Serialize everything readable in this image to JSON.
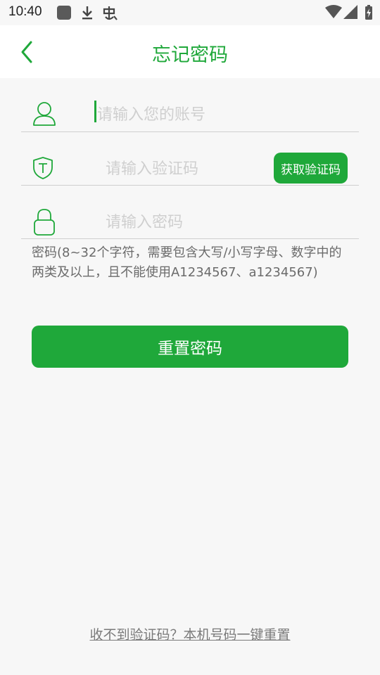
{
  "status_bar": {
    "time": "10:40",
    "icons": [
      "app-square-icon",
      "download-icon",
      "bug-icon",
      "wifi-icon",
      "signal-icon",
      "battery-charging-icon"
    ]
  },
  "header": {
    "back_icon": "chevron-left-icon",
    "title": "忘记密码"
  },
  "form": {
    "account": {
      "icon": "user-icon",
      "placeholder": "请输入您的账号",
      "value": ""
    },
    "code": {
      "icon": "shield-icon",
      "placeholder": "请输入验证码",
      "value": "",
      "get_code_label": "获取验证码"
    },
    "password": {
      "icon": "lock-icon",
      "placeholder": "请输入密码",
      "value": ""
    },
    "hint": "密码(8~32个字符，需要包含大写/小写字母、数字中的两类及以上，且不能使用A1234567、a1234567)"
  },
  "actions": {
    "reset_label": "重置密码",
    "bottom_link": "收不到验证码？本机号码一键重置"
  },
  "colors": {
    "accent": "#1fa83a",
    "background": "#f7f7f7",
    "divider": "#cfcfcf"
  }
}
